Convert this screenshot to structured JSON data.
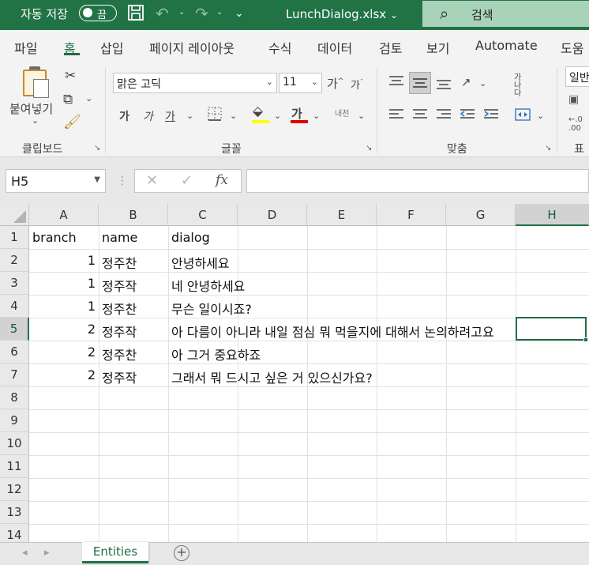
{
  "titlebar": {
    "autosave_label": "자동 저장",
    "autosave_state": "끔",
    "filename": "LunchDialog.xlsx",
    "filename_caret": "⌄",
    "search_label": "검색"
  },
  "ribbon_tabs": [
    "파일",
    "홈",
    "삽입",
    "페이지 레이아웃",
    "수식",
    "데이터",
    "검토",
    "보기",
    "Automate",
    "도움"
  ],
  "active_tab": "홈",
  "ribbon": {
    "clipboard": {
      "paste_label": "붙여넣기",
      "group_label": "클립보드"
    },
    "font": {
      "font_name": "맑은 고딕",
      "font_size": "11",
      "bold": "가",
      "italic": "가",
      "underline": "가",
      "grow": "가",
      "shrink": "가",
      "font_color_glyph": "가",
      "phonetic": "내천",
      "group_label": "글꼴",
      "fill_color": "#ffff00",
      "font_color": "#e00000"
    },
    "alignment": {
      "wrap_text": "가나다",
      "group_label": "맞춤"
    },
    "number": {
      "format": "일반",
      "group_label": "표시"
    }
  },
  "formula_bar": {
    "name_box": "H5",
    "formula": ""
  },
  "grid": {
    "columns": [
      "A",
      "B",
      "C",
      "D",
      "E",
      "F",
      "G",
      "H"
    ],
    "rows": [
      "1",
      "2",
      "3",
      "4",
      "5",
      "6",
      "7",
      "8",
      "9",
      "10",
      "11",
      "12",
      "13",
      "14"
    ],
    "selected_column": "H",
    "selected_row": "5",
    "cells": [
      [
        "branch",
        "name",
        "dialog"
      ],
      [
        "1",
        "정주찬",
        "안녕하세요"
      ],
      [
        "1",
        "정주작",
        "네 안녕하세요"
      ],
      [
        "1",
        "정주찬",
        "무슨 일이시죠?"
      ],
      [
        "2",
        "정주작",
        "아 다름이 아니라 내일 점심 뭐 먹을지에 대해서 논의하려고요"
      ],
      [
        "2",
        "정주찬",
        "아 그거 중요하죠"
      ],
      [
        "2",
        "정주작",
        "그래서 뭐 드시고 싶은 거 있으신가요?"
      ]
    ]
  },
  "sheet_tabs": {
    "active": "Entities",
    "add_label": "+"
  }
}
